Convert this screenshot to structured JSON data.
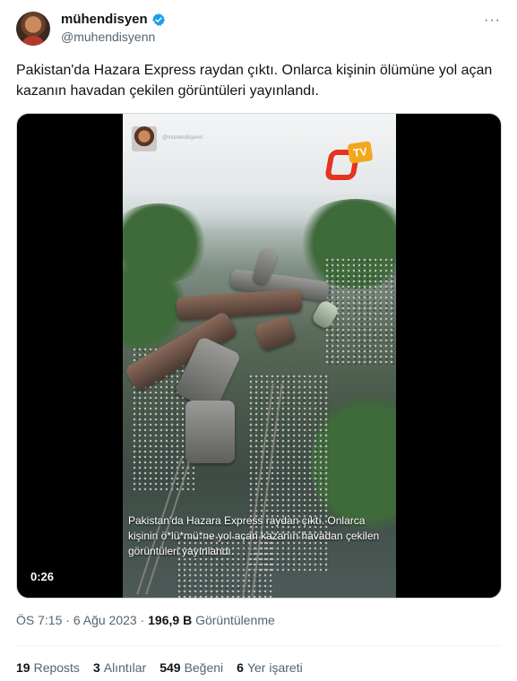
{
  "user": {
    "display_name": "mühendisyen",
    "handle": "@muhendisyenn"
  },
  "more_label": "···",
  "tweet": {
    "text": "Pakistan'da Hazara Express raydan çıktı. Onlarca kişinin ölümüne yol açan kazanın havadan çekilen görüntüleri yayınlandı."
  },
  "video": {
    "overlay_handle": "@muhendisyenn",
    "logo_text": "TV",
    "caption": "Pakistan'da Hazara Express raydan çıktı. Onlarca kişinin ö*lü*mü*ne yol açan kazanın havadan çekilen görüntüleri yayınlandı.",
    "duration": "0:26"
  },
  "meta": {
    "time": "ÖS 7:15",
    "separator": "·",
    "date": "6 Ağu 2023",
    "views_count": "196,9 B",
    "views_label": "Görüntülenme"
  },
  "stats": [
    {
      "count": "19",
      "label": "Reposts"
    },
    {
      "count": "3",
      "label": "Alıntılar"
    },
    {
      "count": "549",
      "label": "Beğeni"
    },
    {
      "count": "6",
      "label": "Yer işareti"
    }
  ],
  "colors": {
    "verified": "#1d9bf0",
    "text": "#0f1419",
    "secondary": "#536471"
  }
}
